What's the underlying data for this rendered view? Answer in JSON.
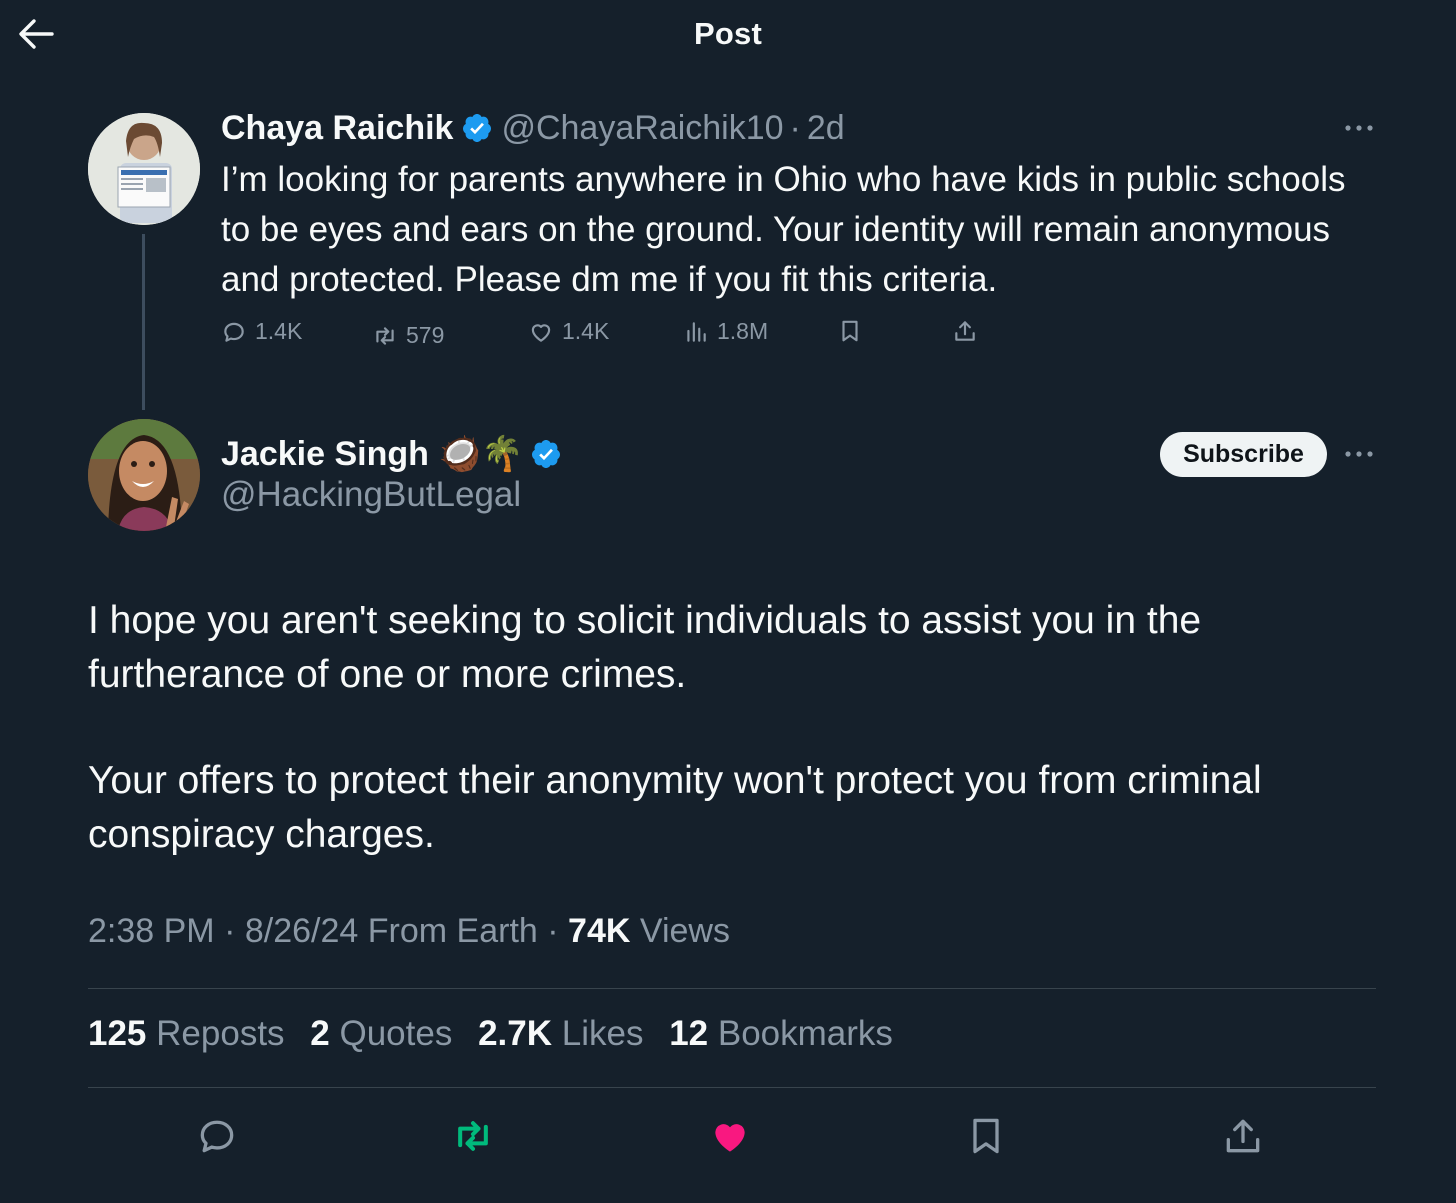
{
  "header": {
    "title": "Post"
  },
  "parent_post": {
    "author_name": "Chaya Raichik",
    "handle": "@ChayaRaichik10",
    "separator": "·",
    "time": "2d",
    "text": "I’m looking for parents anywhere in Ohio who have kids in public schools to be eyes and ears on the ground. Your identity will remain anonymous and protected. Please dm me if you fit this criteria.",
    "actions": {
      "replies": "1.4K",
      "reposts": "579",
      "likes": "1.4K",
      "views": "1.8M"
    }
  },
  "post": {
    "author_name": "Jackie Singh",
    "emoji": "🥥🌴",
    "handle": "@HackingButLegal",
    "subscribe_label": "Subscribe",
    "paragraphs": [
      "I hope you aren't seeking to solicit individuals to assist you in the furtherance of one or more crimes.",
      "Your offers to protect their anonymity won't protect you from criminal conspiracy charges."
    ],
    "meta": {
      "time": "2:38 PM",
      "sep1": "·",
      "date": "8/26/24",
      "source": "From Earth",
      "sep2": "·",
      "views_count": "74K",
      "views_label": "Views"
    },
    "stats": {
      "reposts_count": "125",
      "reposts_label": "Reposts",
      "quotes_count": "2",
      "quotes_label": "Quotes",
      "likes_count": "2.7K",
      "likes_label": "Likes",
      "bookmarks_count": "12",
      "bookmarks_label": "Bookmarks"
    }
  },
  "icons": {
    "back": "arrow-left-icon",
    "verified": "verified-badge-icon",
    "more": "more-dots-icon",
    "reply": "reply-icon",
    "repost": "repost-icon",
    "like": "heart-icon",
    "views": "views-chart-icon",
    "bookmark": "bookmark-icon",
    "share": "share-icon"
  },
  "colors": {
    "background": "#15202b",
    "text": "#f7f9f9",
    "muted": "#8b98a5",
    "verified": "#1d9bf0",
    "repost_active": "#00ba7c",
    "like_active": "#f91880",
    "divider": "#38444d"
  }
}
